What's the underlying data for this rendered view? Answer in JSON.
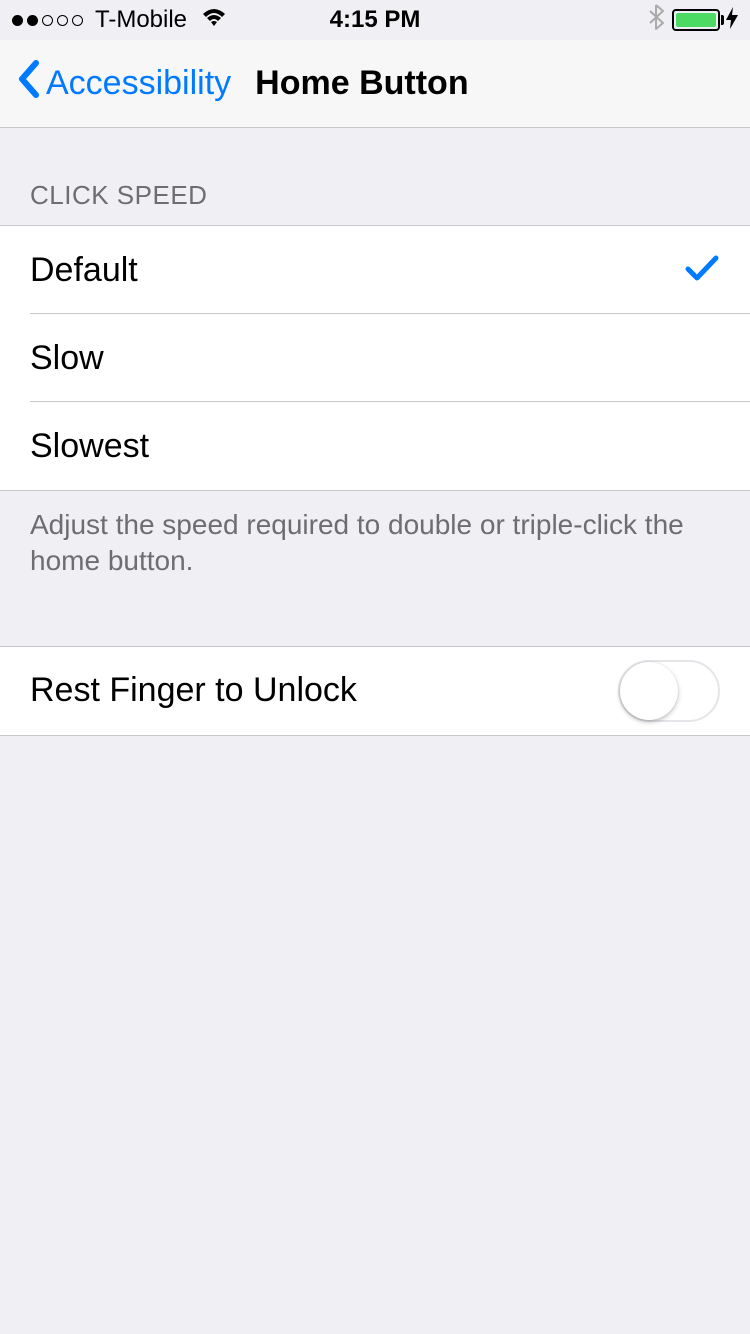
{
  "status": {
    "carrier": "T-Mobile",
    "time": "4:15 PM"
  },
  "nav": {
    "back_label": "Accessibility",
    "title": "Home Button"
  },
  "click_speed": {
    "header": "CLICK SPEED",
    "options": [
      {
        "label": "Default",
        "selected": true
      },
      {
        "label": "Slow",
        "selected": false
      },
      {
        "label": "Slowest",
        "selected": false
      }
    ],
    "footer": "Adjust the speed required to double or triple-click the home button."
  },
  "rest_finger": {
    "label": "Rest Finger to Unlock",
    "enabled": false
  }
}
